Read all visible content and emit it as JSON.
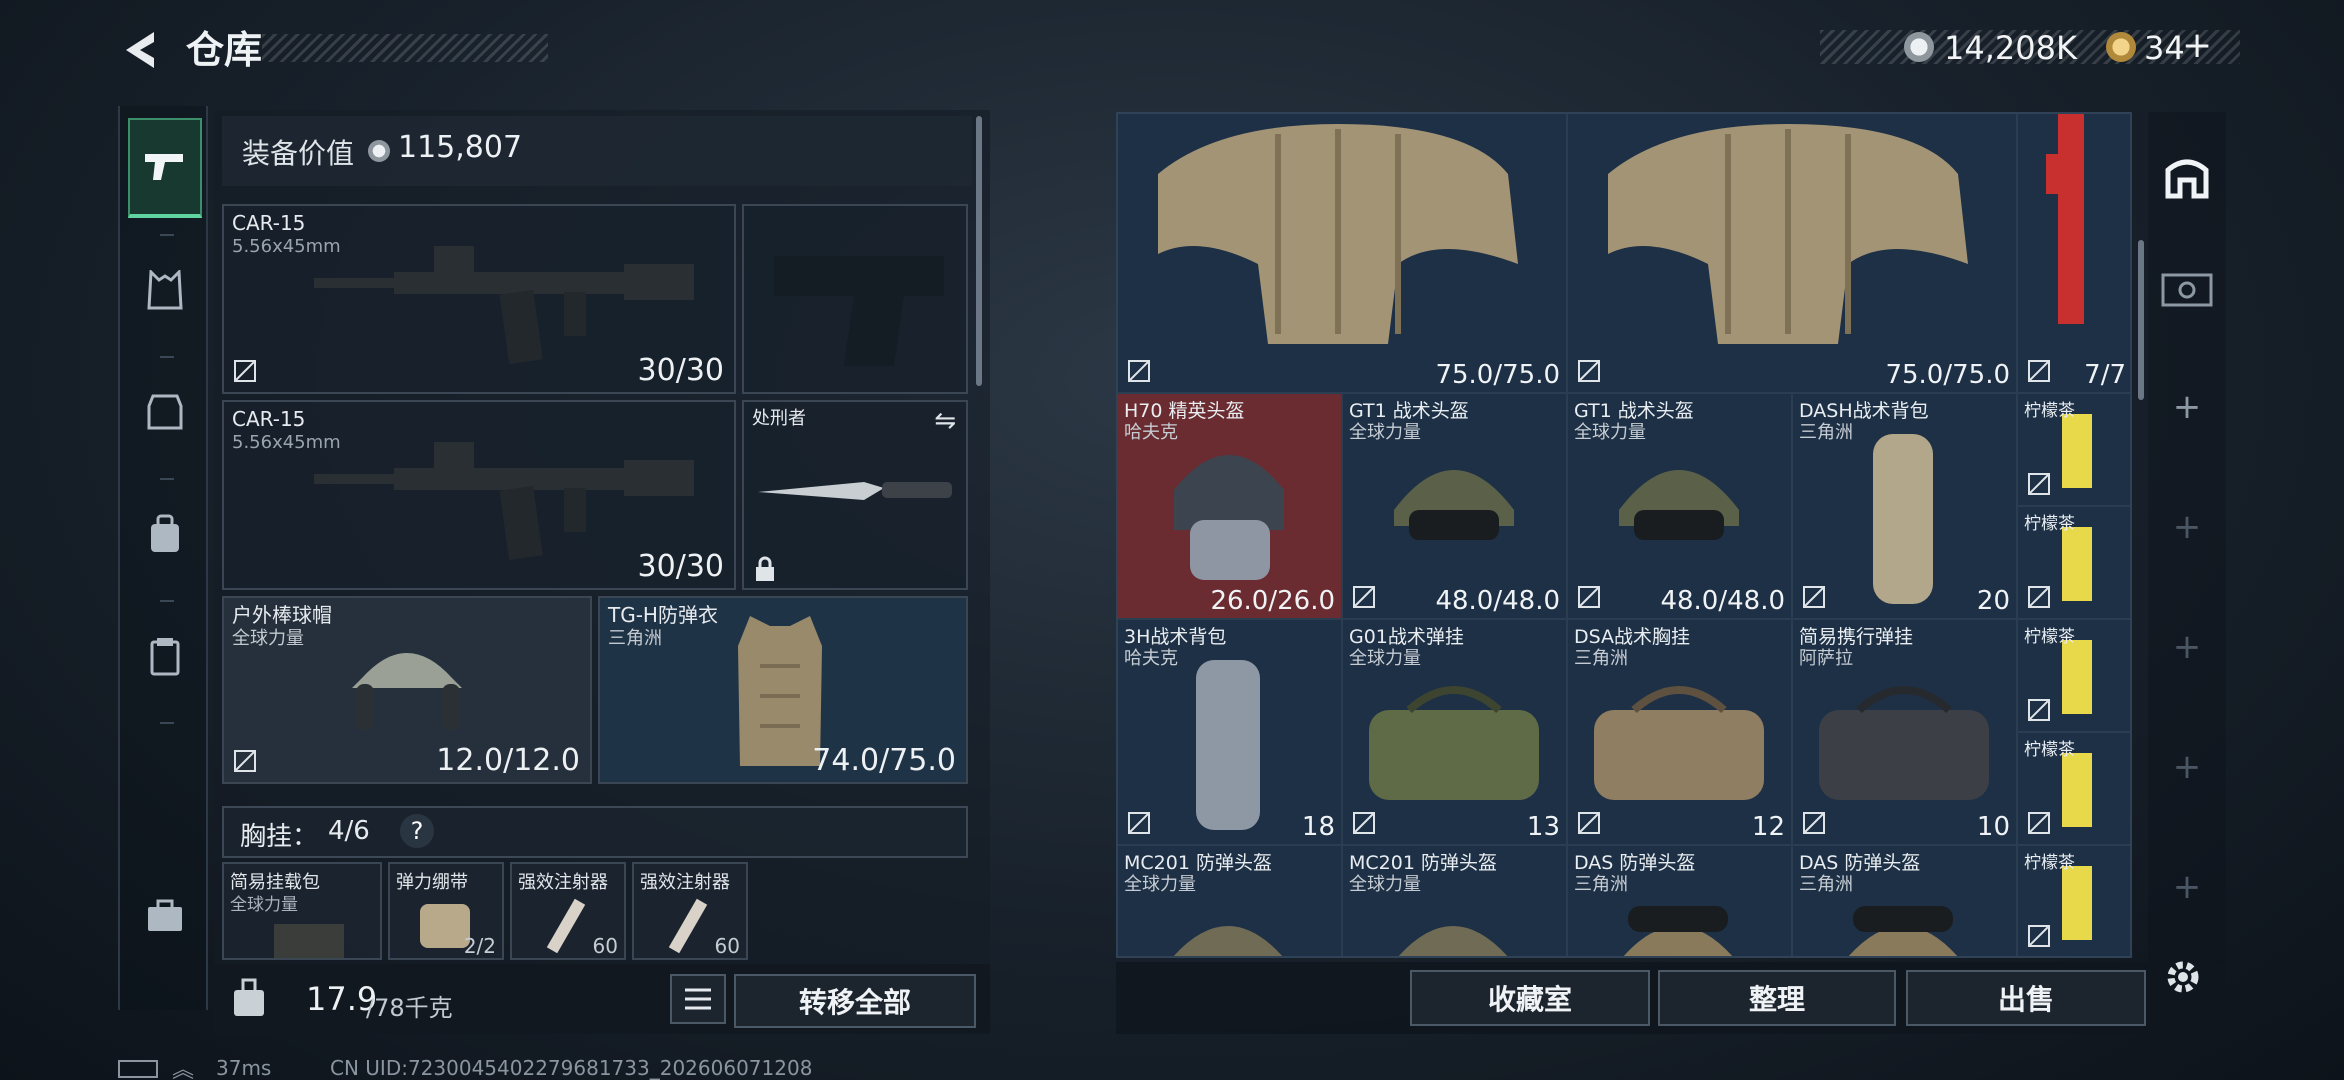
{
  "header": {
    "title": "仓库",
    "currency_1": "14,208K",
    "currency_2": "34",
    "add_icon": "+"
  },
  "left": {
    "equip_value_label": "装备价值",
    "equip_value": "115,807",
    "primary_1": {
      "name": "CAR-15",
      "ammo": "5.56x45mm",
      "count": "30/30"
    },
    "primary_2": {
      "name": "CAR-15",
      "ammo": "5.56x45mm",
      "count": "30/30"
    },
    "melee": {
      "name": "处刑者"
    },
    "helmet": {
      "name": "户外棒球帽",
      "brand": "全球力量",
      "durability": "12.0/12.0"
    },
    "armor": {
      "name": "TG-H防弹衣",
      "brand": "三角洲",
      "durability": "74.0/75.0"
    },
    "chest_label": "胸挂：",
    "chest_count": "4/6",
    "chest_help": "?",
    "chest_items": [
      {
        "name": "简易挂载包",
        "sub": "全球力量"
      },
      {
        "name": "弹力绷带",
        "sub": "2/2"
      },
      {
        "name": "强效注射器",
        "sub": "60"
      },
      {
        "name": "强效注射器",
        "sub": "60"
      }
    ],
    "weight_current": "17.9",
    "weight_max": "/78千克",
    "transfer_all": "转移全部"
  },
  "grid": {
    "rows": [
      [
        {
          "name": "",
          "sub": "",
          "count": "75.0/75.0"
        },
        {
          "name": "",
          "sub": "",
          "count": "75.0/75.0"
        },
        {
          "name": "",
          "sub": "",
          "count": "7/7"
        }
      ],
      [
        {
          "name": "H70 精英头盔",
          "sub": "哈夫克",
          "count": "26.0/26.0"
        },
        {
          "name": "GT1 战术头盔",
          "sub": "全球力量",
          "count": "48.0/48.0"
        },
        {
          "name": "GT1 战术头盔",
          "sub": "全球力量",
          "count": "48.0/48.0"
        },
        {
          "name": "DASH战术背包",
          "sub": "三角洲",
          "count": "20"
        }
      ],
      [
        {
          "name": "3H战术背包",
          "sub": "哈夫克",
          "count": "18"
        },
        {
          "name": "G01战术弹挂",
          "sub": "全球力量",
          "count": "13"
        },
        {
          "name": "DSA战术胸挂",
          "sub": "三角洲",
          "count": "12"
        },
        {
          "name": "简易携行弹挂",
          "sub": "阿萨拉",
          "count": "10"
        }
      ],
      [
        {
          "name": "MC201 防弹头盔",
          "sub": "全球力量"
        },
        {
          "name": "MC201 防弹头盔",
          "sub": "全球力量"
        },
        {
          "name": "DAS 防弹头盔",
          "sub": "三角洲"
        },
        {
          "name": "DAS 防弹头盔",
          "sub": "三角洲"
        }
      ]
    ],
    "lemon_tea": "柠檬茶"
  },
  "bottom": {
    "collection": "收藏室",
    "organize": "整理",
    "sell": "出售"
  },
  "status": {
    "ping": "37ms",
    "uid": "CN UID:7230045402279681733_202606071208"
  },
  "colors": {
    "accent_green": "#5fd3a0",
    "slot_blue": "#1d3045",
    "slot_red": "#6a2c30"
  }
}
